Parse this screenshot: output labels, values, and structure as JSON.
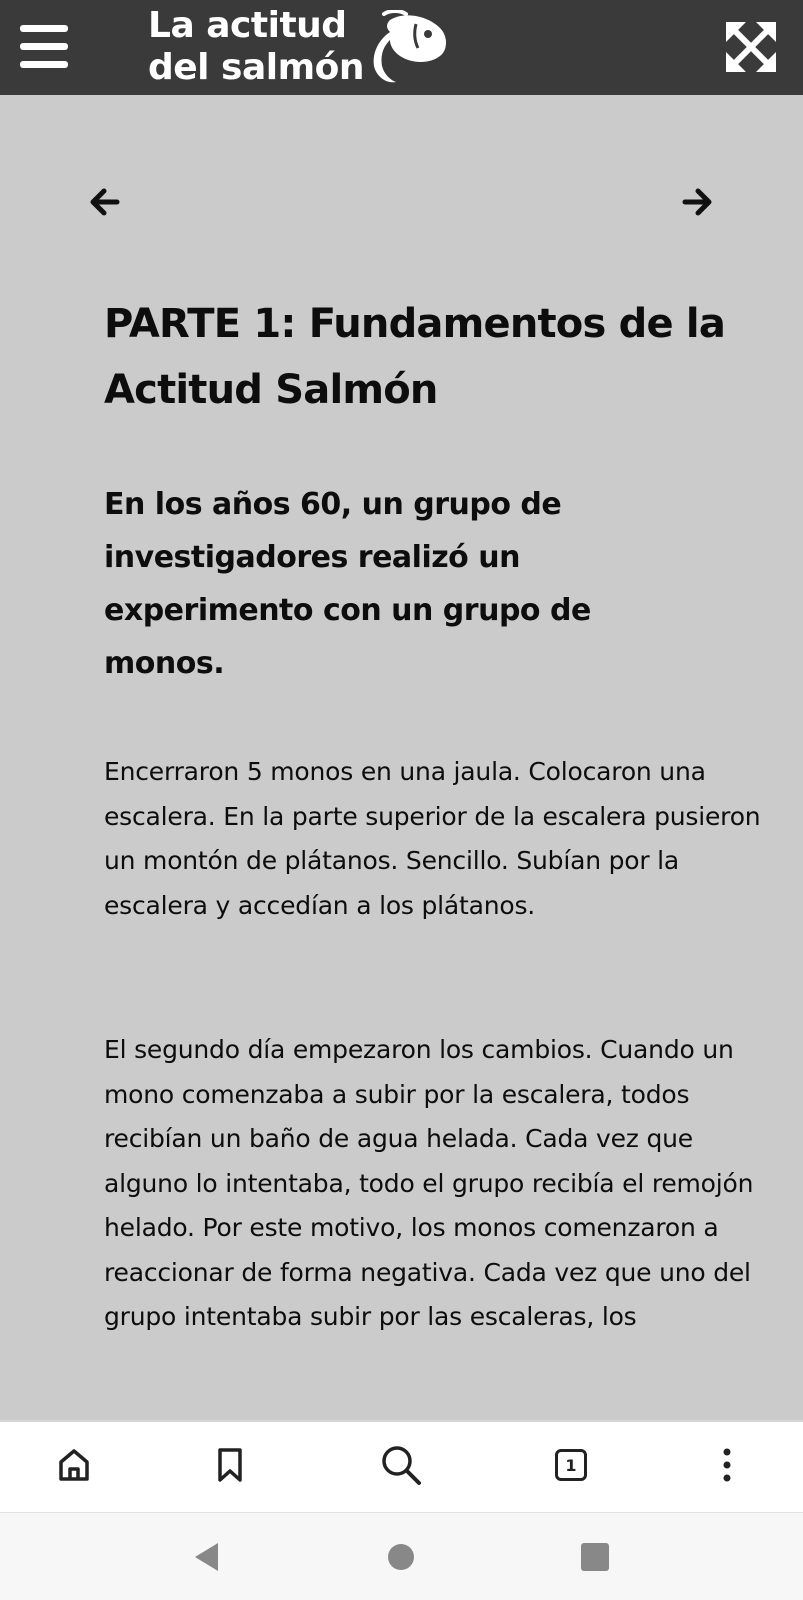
{
  "header": {
    "logo_line1": "La actitud",
    "logo_line2": "del salmón",
    "logo_icon": "salmon-fish-icon",
    "menu_icon": "hamburger-menu-icon",
    "expand_icon": "expand-arrows-icon",
    "background_color": "#3a3a3a"
  },
  "navigation": {
    "prev_icon": "arrow-left-icon",
    "next_icon": "arrow-right-icon"
  },
  "article": {
    "title": "PARTE 1: Fundamentos de la Actitud Salmón",
    "lead": "En los años 60, un grupo de investigadores realizó un experimento con un grupo de monos.",
    "paragraphs": [
      "Encerraron 5 monos en una jaula. Colocaron una escalera. En la parte superior de la escalera pusieron un montón de plátanos. Sencillo. Subían por la escalera y accedían a los plátanos.",
      "El segundo día empezaron los cambios. Cuando un mono comenzaba a subir por la escalera, todos recibían un baño de agua helada. Cada vez que alguno lo intentaba, todo el grupo recibía el remojón helado. Por este motivo, los monos comenzaron a reaccionar de forma negativa. Cada vez que uno del grupo intentaba subir por las escaleras, los"
    ],
    "background_color": "#cbcbcb"
  },
  "browser_toolbar": {
    "home_icon": "home-icon",
    "bookmark_icon": "bookmark-icon",
    "search_icon": "search-icon",
    "tab_count": "1",
    "menu_icon": "more-vertical-icon"
  },
  "system_nav": {
    "back_icon": "triangle-back-icon",
    "home_icon": "circle-home-icon",
    "recents_icon": "square-recents-icon"
  }
}
